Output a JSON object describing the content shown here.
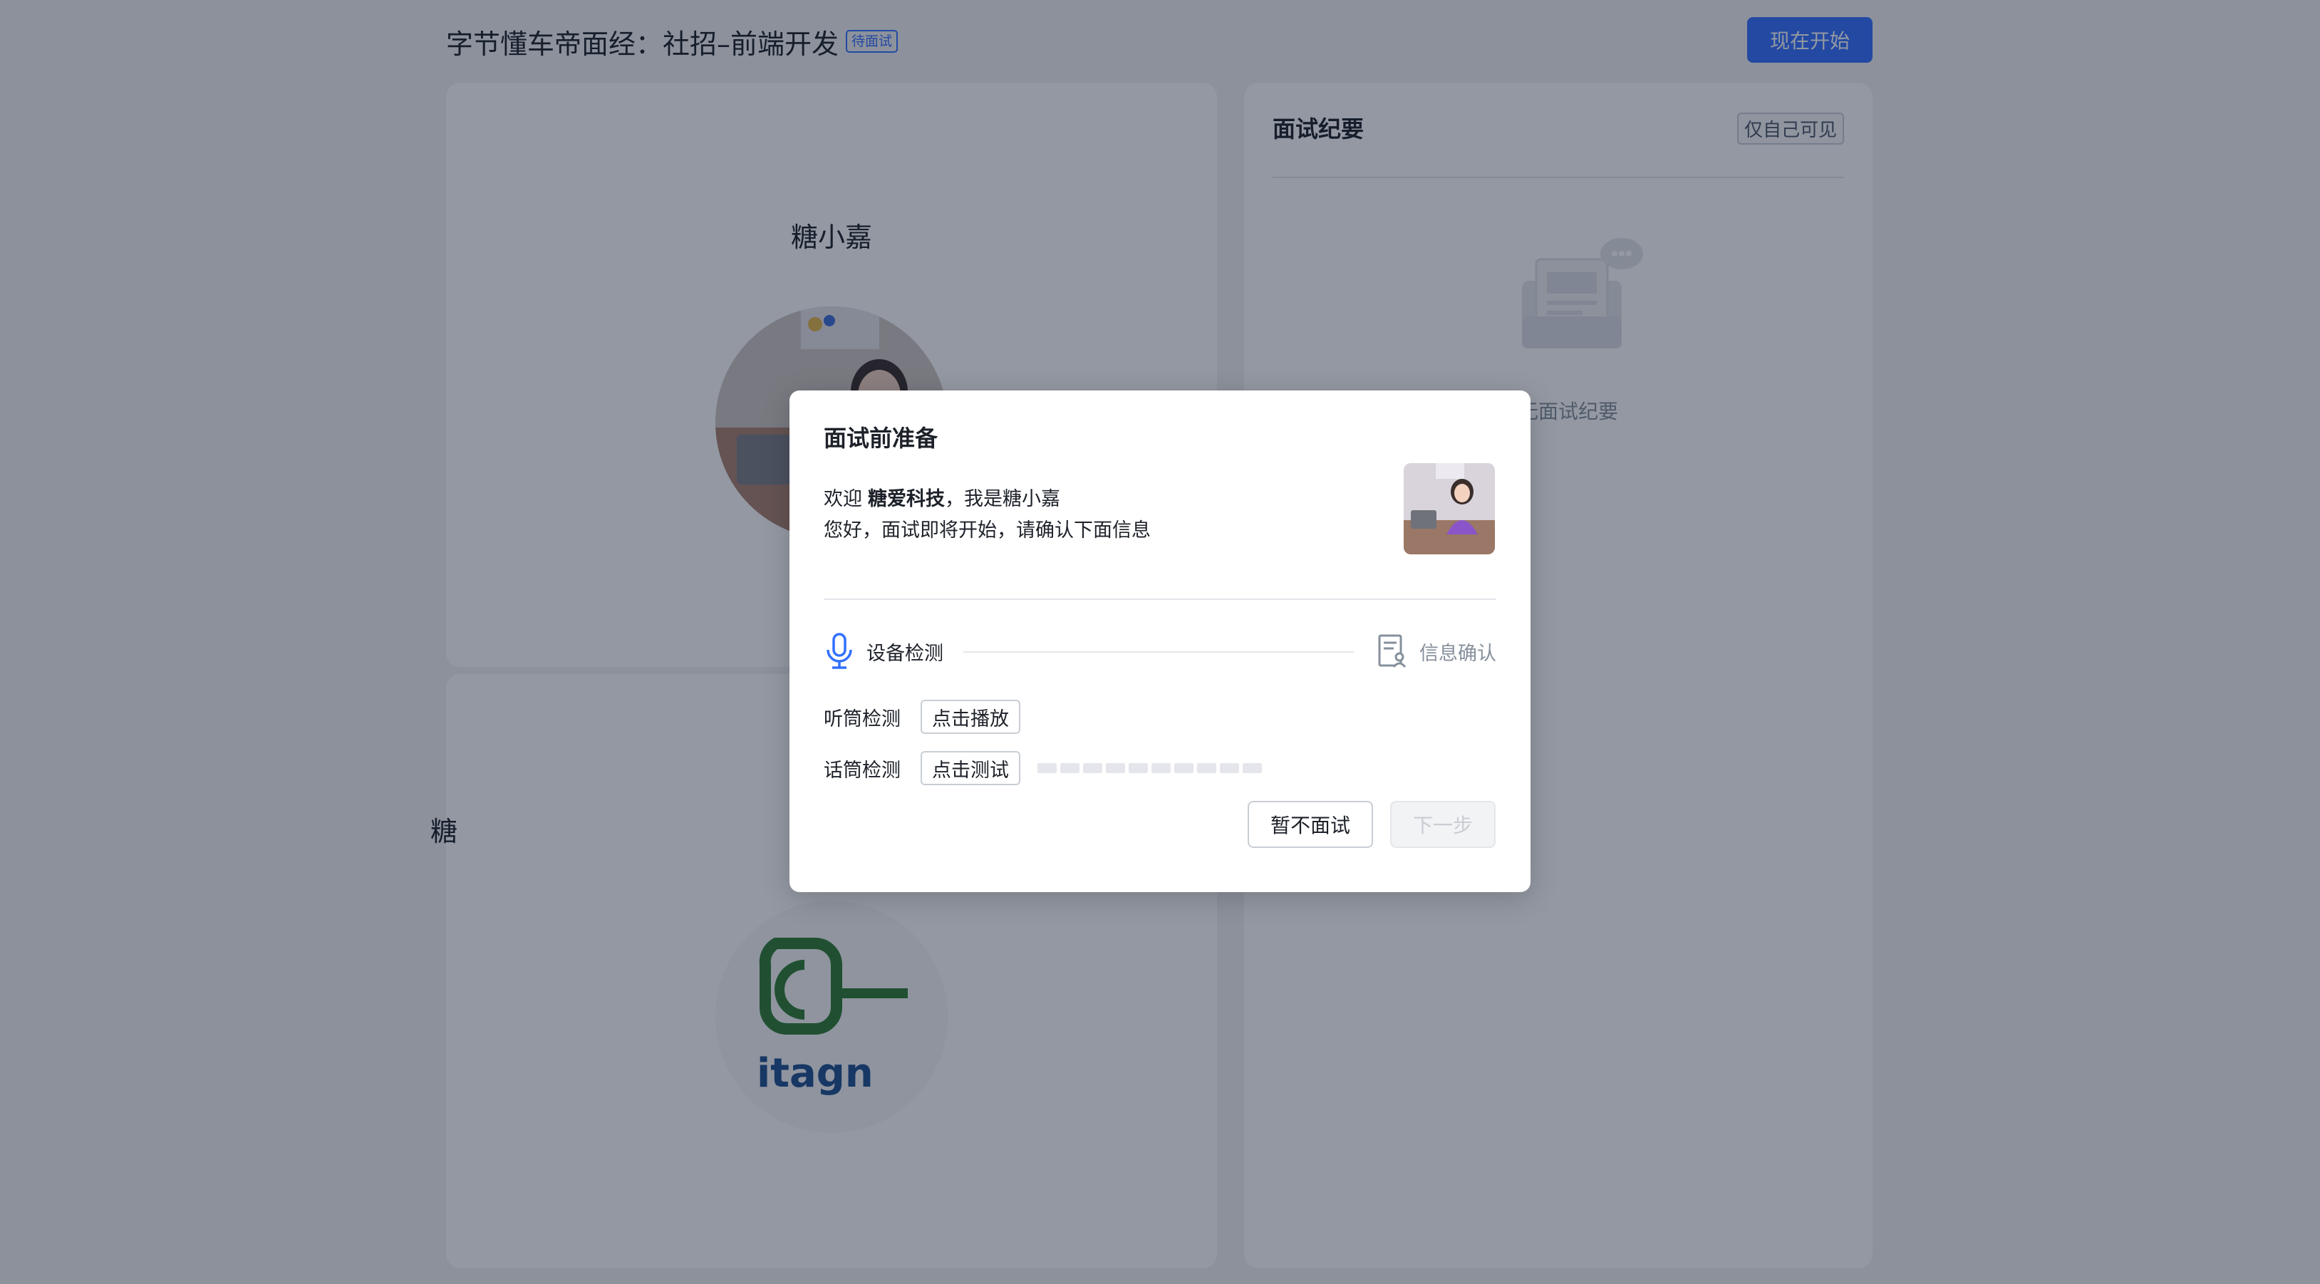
{
  "header": {
    "title": "字节懂车帝面经：社招–前端开发",
    "status_tag": "待面试",
    "start_button": "现在开始"
  },
  "interviewer_card": {
    "name": "糖小嘉"
  },
  "candidate_card": {
    "name": "糖",
    "logo_text": "itagn"
  },
  "summary_panel": {
    "title": "面试纪要",
    "visibility_tag": "仅自己可见",
    "empty_text": "暂无面试纪要"
  },
  "modal": {
    "title": "面试前准备",
    "welcome_prefix": "欢迎",
    "company": "糖爱科技",
    "welcome_suffix": "，我是糖小嘉",
    "intro": "您好，面试即将开始，请确认下面信息",
    "steps": [
      {
        "label": "设备检测",
        "icon": "microphone-icon",
        "active": true
      },
      {
        "label": "信息确认",
        "icon": "document-user-icon",
        "active": false
      }
    ],
    "speaker_check": {
      "label": "听筒检测",
      "button": "点击播放"
    },
    "mic_check": {
      "label": "话筒检测",
      "button": "点击测试",
      "level": 0
    },
    "buttons": {
      "skip": "暂不面试",
      "next": "下一步"
    }
  },
  "colors": {
    "primary": "#3370ff",
    "logo_green": "#2e7d32",
    "logo_blue": "#1e4f8f"
  }
}
